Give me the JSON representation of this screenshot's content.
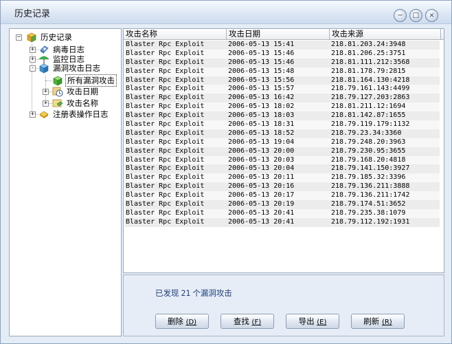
{
  "window": {
    "title": "历史记录"
  },
  "controls": {
    "minimize": "−",
    "maximize": "□",
    "close": "×"
  },
  "tree": {
    "root": {
      "label": "历史记录",
      "icon": "history-box-icon"
    },
    "items": [
      {
        "label": "病毒日志",
        "icon": "virus-log-icon",
        "expander": "+"
      },
      {
        "label": "监控日志",
        "icon": "monitor-umbrella-icon",
        "expander": "+"
      },
      {
        "label": "漏洞攻击日志",
        "icon": "exploit-log-icon",
        "expander": "-"
      },
      {
        "label": "所有漏洞攻击",
        "icon": "all-exploits-icon",
        "selected": true
      },
      {
        "label": "攻击日期",
        "icon": "attack-date-icon",
        "expander": "+"
      },
      {
        "label": "攻击名称",
        "icon": "attack-name-icon",
        "expander": "+"
      },
      {
        "label": "注册表操作日志",
        "icon": "registry-log-icon",
        "expander": "+"
      }
    ]
  },
  "table": {
    "columns": [
      "攻击名称",
      "攻击日期",
      "攻击来源"
    ],
    "rows": [
      [
        "Blaster Rpc Exploit",
        "2006-05-13 15:41",
        "218.81.203.24:3948"
      ],
      [
        "Blaster Rpc Exploit",
        "2006-05-13 15:46",
        "218.81.206.25:3751"
      ],
      [
        "Blaster Rpc Exploit",
        "2006-05-13 15:46",
        "218.81.111.212:3568"
      ],
      [
        "Blaster Rpc Exploit",
        "2006-05-13 15:48",
        "218.81.178.79:2815"
      ],
      [
        "Blaster Rpc Exploit",
        "2006-05-13 15:56",
        "218.81.164.130:4218"
      ],
      [
        "Blaster Rpc Exploit",
        "2006-05-13 15:57",
        "218.79.161.143:4499"
      ],
      [
        "Blaster Rpc Exploit",
        "2006-05-13 16:42",
        "218.79.127.203:2863"
      ],
      [
        "Blaster Rpc Exploit",
        "2006-05-13 18:02",
        "218.81.211.12:1694"
      ],
      [
        "Blaster Rpc Exploit",
        "2006-05-13 18:03",
        "218.81.142.87:1655"
      ],
      [
        "Blaster Rpc Exploit",
        "2006-05-13 18:31",
        "218.79.119.179:1132"
      ],
      [
        "Blaster Rpc Exploit",
        "2006-05-13 18:52",
        "218.79.23.34:3360"
      ],
      [
        "Blaster Rpc Exploit",
        "2006-05-13 19:04",
        "218.79.248.20:3963"
      ],
      [
        "Blaster Rpc Exploit",
        "2006-05-13 20:00",
        "218.79.230.95:3655"
      ],
      [
        "Blaster Rpc Exploit",
        "2006-05-13 20:03",
        "218.79.168.20:4818"
      ],
      [
        "Blaster Rpc Exploit",
        "2006-05-13 20:04",
        "218.79.141.150:3927"
      ],
      [
        "Blaster Rpc Exploit",
        "2006-05-13 20:11",
        "218.79.185.32:3396"
      ],
      [
        "Blaster Rpc Exploit",
        "2006-05-13 20:16",
        "218.79.136.211:3888"
      ],
      [
        "Blaster Rpc Exploit",
        "2006-05-13 20:17",
        "218.79.136.211:1742"
      ],
      [
        "Blaster Rpc Exploit",
        "2006-05-13 20:19",
        "218.79.174.51:3652"
      ],
      [
        "Blaster Rpc Exploit",
        "2006-05-13 20:41",
        "218.79.235.38:1079"
      ],
      [
        "Blaster Rpc Exploit",
        "2006-05-13 20:41",
        "218.79.112.192:1931"
      ]
    ]
  },
  "status": {
    "prefix": "已发现",
    "count": "21",
    "suffix": "个漏洞攻击"
  },
  "buttons": [
    {
      "label": "删除",
      "accel": "(D)",
      "name": "delete-button"
    },
    {
      "label": "查找",
      "accel": "(F)",
      "name": "find-button"
    },
    {
      "label": "导出",
      "accel": "(E)",
      "name": "export-button"
    },
    {
      "label": "刷新",
      "accel": "(R)",
      "name": "refresh-button"
    }
  ],
  "colors": {
    "selection": "#316ac5",
    "window_bg": "#e4ecf6",
    "title_text": "#1a1a1a"
  }
}
